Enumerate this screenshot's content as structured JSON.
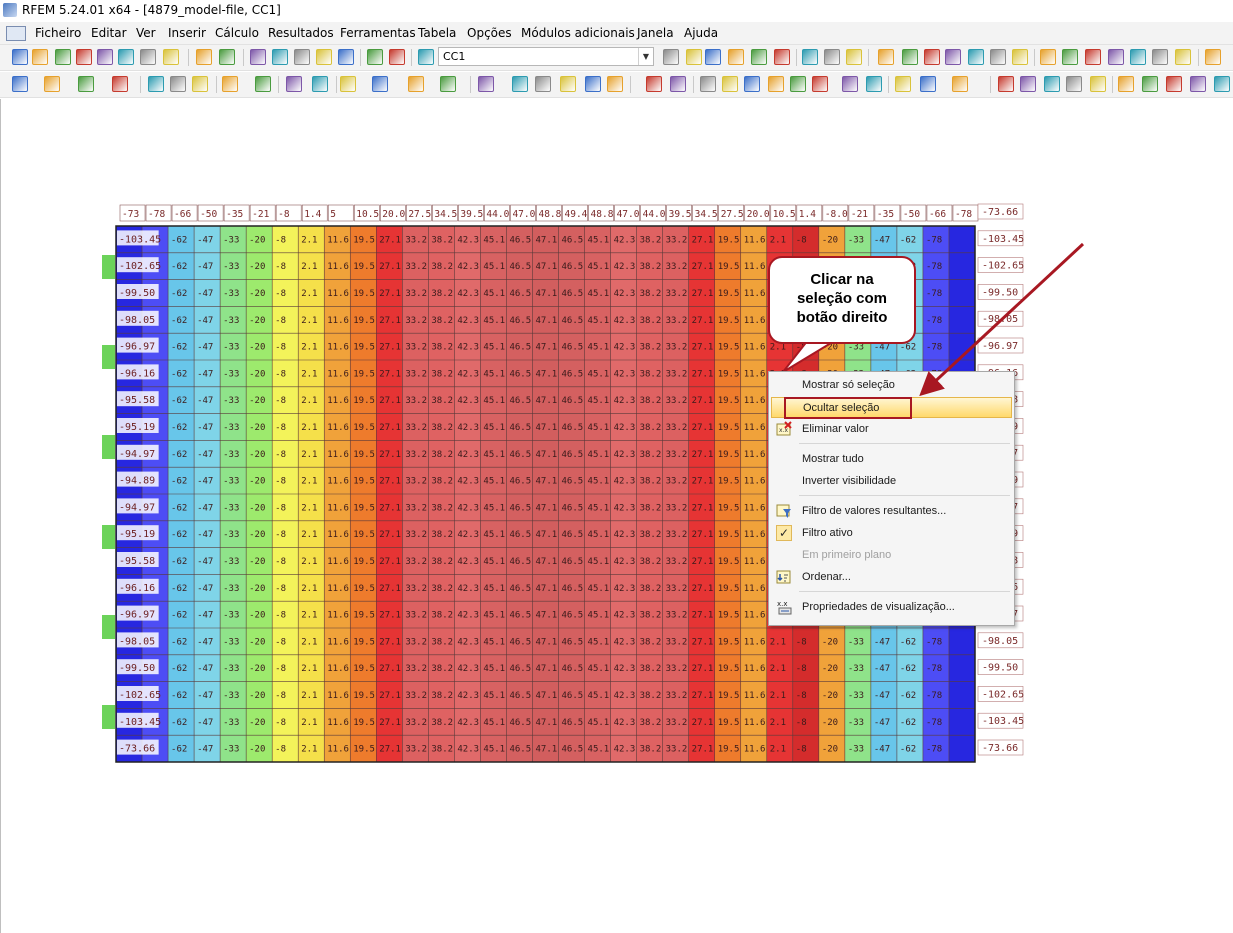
{
  "window": {
    "title": "RFEM 5.24.01 x64 - [4879_model-file, CC1]"
  },
  "menu": [
    "Ficheiro",
    "Editar",
    "Ver",
    "Inserir",
    "Cálculo",
    "Resultados",
    "Ferramentas",
    "Tabela",
    "Opções",
    "Módulos adicionais",
    "Janela",
    "Ajuda"
  ],
  "toolbar": {
    "load_case": "CC1"
  },
  "callout": {
    "line1": "Clicar na",
    "line2": "seleção com",
    "line3": "botão direito"
  },
  "context_menu": {
    "items": [
      {
        "label": "Mostrar só seleção",
        "icon": "",
        "enabled": true
      },
      {
        "label": "Ocultar seleção",
        "icon": "",
        "enabled": true,
        "highlighted": true
      },
      {
        "label": "Eliminar valor",
        "icon": "delete-value-icon",
        "enabled": true
      },
      {
        "label": "Mostrar tudo",
        "icon": "",
        "enabled": true
      },
      {
        "label": "Inverter visibilidade",
        "icon": "",
        "enabled": true
      },
      {
        "label": "Filtro de valores resultantes...",
        "icon": "result-filter-icon",
        "enabled": true
      },
      {
        "label": "Filtro ativo",
        "icon": "checkmark-icon",
        "enabled": true,
        "checked": true
      },
      {
        "label": "Em primeiro plano",
        "icon": "",
        "enabled": false
      },
      {
        "label": "Ordenar...",
        "icon": "sort-icon",
        "enabled": true
      },
      {
        "label": "Propriedades de visualização...",
        "icon": "display-properties-icon",
        "enabled": true
      }
    ]
  },
  "mesh": {
    "row_labels_left": [
      "-103.45",
      "-102.65",
      "-99.50",
      "-98.05",
      "-96.97",
      "-96.16",
      "-95.58",
      "-95.19",
      "-94.97",
      "-94.89",
      "-94.97",
      "-95.19",
      "-95.58",
      "-96.16",
      "-96.97",
      "-98.05",
      "-99.50",
      "-102.65",
      "-103.45",
      "-73.66"
    ],
    "row_labels_right": [
      "-73.66",
      "-103.45",
      "-102.65",
      "-99.50",
      "-98.05",
      "-96.97",
      "-96.16",
      "-95.58",
      "-95.19",
      "-94.97",
      "-94.89",
      "-94.97",
      "-95.19",
      "-95.58",
      "-96.16",
      "-96.97",
      "-98.05",
      "-99.50",
      "-102.65",
      "-103.45",
      "-73.66"
    ],
    "top_row": [
      "-73",
      "-78",
      "-66",
      "-50",
      "-35",
      "-21",
      "-8",
      "1.4",
      "5",
      "10.5",
      "20.0",
      "27.5",
      "34.5",
      "39.5",
      "44.0",
      "47.0",
      "48.8",
      "49.4",
      "48.8",
      "47.0",
      "44.0",
      "39.5",
      "34.5",
      "27.5",
      "20.0",
      "10.5",
      "1.4",
      "-8.0",
      "-21",
      "-35",
      "-50",
      "-66",
      "-78"
    ],
    "typical_row": [
      "-62",
      "-47",
      "-33",
      "-20",
      "-8",
      "2.1",
      "11.6",
      "19.5",
      "27.1",
      "33.2",
      "38.2",
      "42.3",
      "45.1",
      "46.5",
      "47.1",
      "46.5",
      "45.1",
      "42.3",
      "38.2",
      "33.2",
      "27.1",
      "19.5",
      "11.6",
      "2.1",
      "-8",
      "-20",
      "-33",
      "-47",
      "-62",
      "-78"
    ]
  }
}
